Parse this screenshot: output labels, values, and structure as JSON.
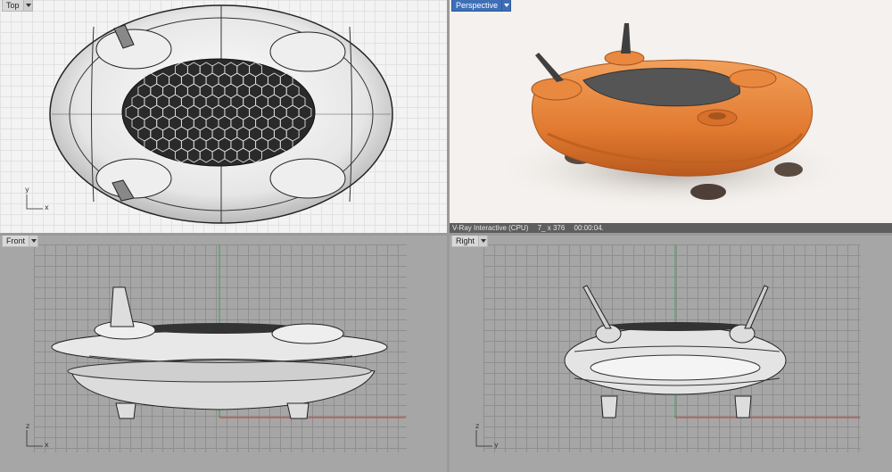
{
  "viewports": {
    "top": {
      "label": "Top",
      "axis_y": "y",
      "axis_x": "x"
    },
    "perspective": {
      "label": "Perspective"
    },
    "front": {
      "label": "Front",
      "axis_v": "z",
      "axis_h": "x"
    },
    "right": {
      "label": "Right",
      "axis_v": "z",
      "axis_h": "y"
    }
  },
  "render_status": {
    "renderer": "V-Ray Interactive (CPU)",
    "resolution": "7_ x 376",
    "elapsed": "00:00:04."
  },
  "colors": {
    "active_tab": "#3e6fb6",
    "model_orange": "#e8833a",
    "x_axis": "#c0392b",
    "y_axis": "#3aa24a"
  }
}
